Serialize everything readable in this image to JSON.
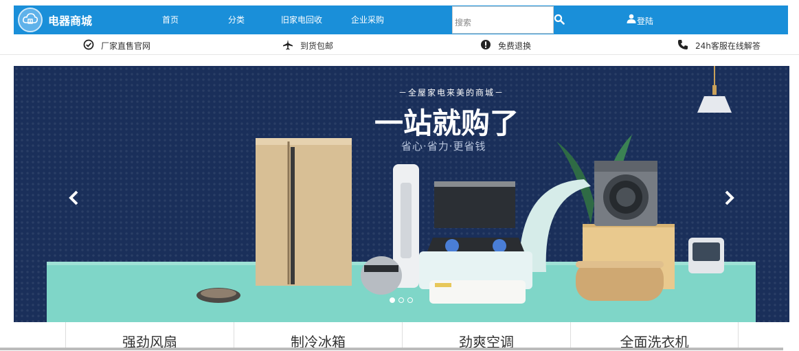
{
  "header": {
    "brand": "电器商城",
    "nav": [
      "首页",
      "分类",
      "旧家电回收",
      "企业采购"
    ],
    "search_placeholder": "搜索",
    "login_label": "登陆"
  },
  "features": [
    {
      "icon": "check-circle-icon",
      "label": "厂家直售官网"
    },
    {
      "icon": "plane-icon",
      "label": "到货包邮"
    },
    {
      "icon": "exclamation-circle-icon",
      "label": "免费退换"
    },
    {
      "icon": "phone-icon",
      "label": "24h客服在线解答"
    }
  ],
  "banner": {
    "tagline": "－全屋家电来美的商城－",
    "headline": "一站就购了",
    "subline": "省心·省力·更省钱"
  },
  "categories": [
    "强劲风扇",
    "制冷冰箱",
    "劲爽空调",
    "全面洗衣机"
  ],
  "colors": {
    "primary": "#1a8fd9",
    "banner_bg": "#1a2f5a",
    "floor": "#7fd6c8"
  }
}
